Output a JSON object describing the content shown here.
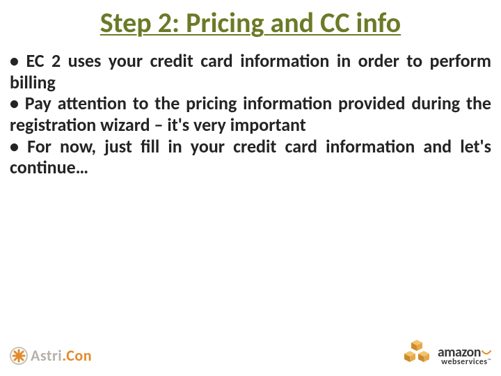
{
  "title": "Step 2: Pricing and CC info",
  "bullets": [
    "EC 2 uses your credit card information in order to perform billing",
    "Pay attention to the pricing information provided during the registration wizard – it's very important",
    "For now, just fill in your credit card information and let's continue…"
  ],
  "footer": {
    "left_logo": {
      "part1": "Astri",
      "part2": "Con"
    },
    "right_logo": {
      "line1": "amazon",
      "line2": "webservices"
    }
  },
  "colors": {
    "title": "#6b7a27",
    "orange": "#e38b2c",
    "gray": "#b5b2ab"
  }
}
